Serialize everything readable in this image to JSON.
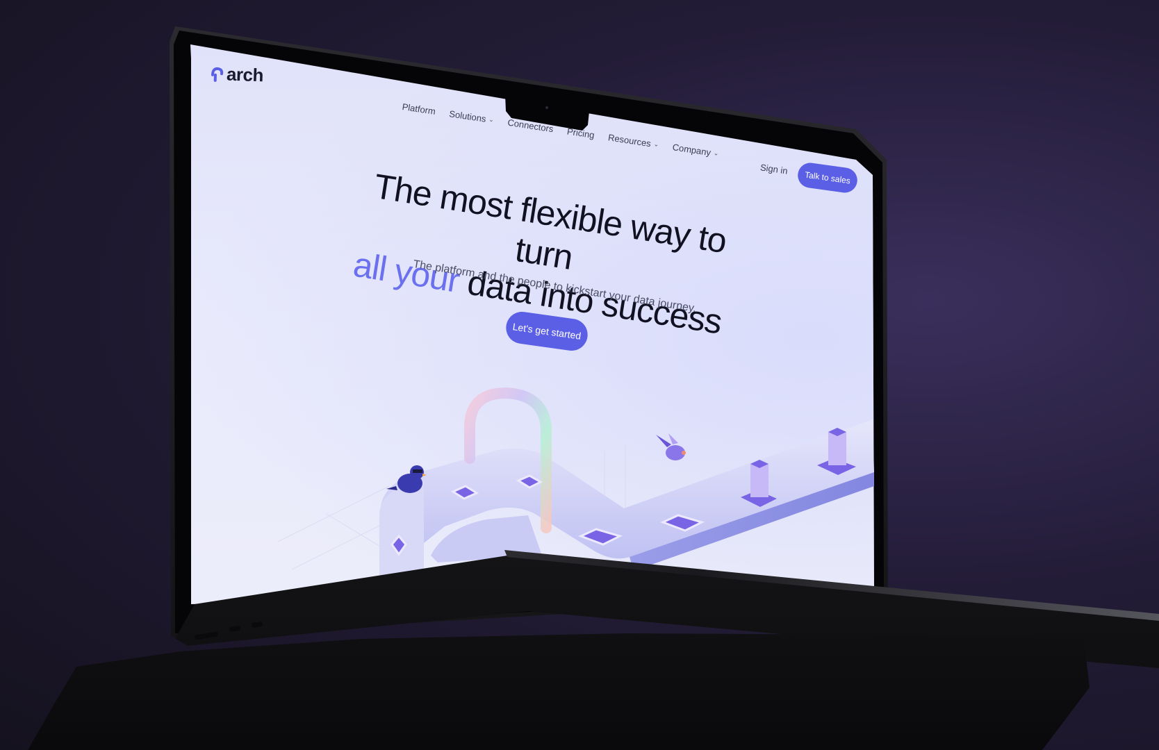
{
  "brand": {
    "name": "arch",
    "accent_color": "#5a5fe6",
    "highlight_color": "#6b70ee"
  },
  "nav": {
    "items": [
      {
        "label": "Platform",
        "has_dropdown": false
      },
      {
        "label": "Solutions",
        "has_dropdown": true
      },
      {
        "label": "Connectors",
        "has_dropdown": false
      },
      {
        "label": "Pricing",
        "has_dropdown": false
      },
      {
        "label": "Resources",
        "has_dropdown": true
      },
      {
        "label": "Company",
        "has_dropdown": true
      }
    ],
    "sign_in": "Sign in",
    "cta": "Talk to sales"
  },
  "hero": {
    "headline_line1": "The most flexible way to turn",
    "headline_accent": "all your",
    "headline_line2_rest": " data into success",
    "subtitle": "The platform and the people to kickstart your data journey.",
    "cta": "Let's get started"
  },
  "icons": {
    "logo": "arch-logo-icon",
    "dropdown": "chevron-down-icon"
  }
}
